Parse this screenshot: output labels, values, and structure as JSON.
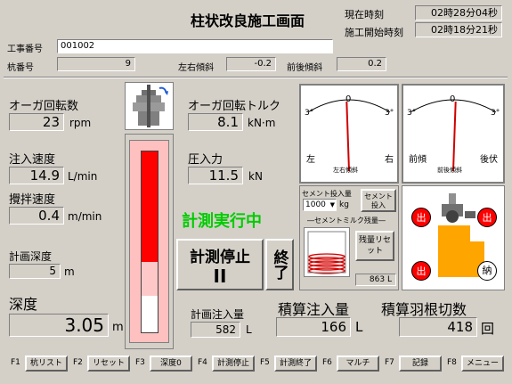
{
  "title": "柱状改良施工画面",
  "clock": {
    "now_label": "現在時刻",
    "now_value": "02時28分04秒",
    "start_label": "施工開始時刻",
    "start_value": "02時18分21秒"
  },
  "job": {
    "label": "工事番号",
    "value": "001002"
  },
  "pile": {
    "label": "杭番号",
    "value": "9"
  },
  "tilt_lr": {
    "label": "左右傾斜",
    "value": "-0.2"
  },
  "tilt_fb": {
    "label": "前後傾斜",
    "value": "0.2"
  },
  "auger_speed": {
    "label": "オーガ回転数",
    "value": "23",
    "unit": "rpm"
  },
  "auger_torque": {
    "label": "オーガ回転トルク",
    "value": "8.1",
    "unit": "kN·m"
  },
  "inject_speed": {
    "label": "注入速度",
    "value": "14.9",
    "unit": "L/min"
  },
  "pressure": {
    "label": "圧入力",
    "value": "11.5",
    "unit": "kN"
  },
  "mix_speed": {
    "label": "攪拌速度",
    "value": "0.4",
    "unit": "m/min"
  },
  "plan_depth": {
    "label": "計画深度",
    "value": "5",
    "unit": "m"
  },
  "depth": {
    "label": "深度",
    "value": "3.05",
    "unit": "m"
  },
  "status": "計測実行中",
  "buttons": {
    "stop_measure": "計測停止",
    "pause_symbol": "II",
    "finish": "終了"
  },
  "gauge_lr": {
    "scale_left": "3°",
    "scale_center": "0",
    "scale_right": "3°",
    "side_left": "左",
    "side_right": "右",
    "caption": "左右傾斜",
    "value": -0.2
  },
  "gauge_fb": {
    "scale_left": "3°",
    "scale_center": "0",
    "scale_right": "3°",
    "side_left": "前傾",
    "side_right": "後伏",
    "caption": "前後傾斜",
    "value": 0.2
  },
  "cement": {
    "input_label": "セメント投入量",
    "input_value": "1000",
    "input_unit": "kg",
    "input_button": "セメント投入",
    "milk_label": "―セメントミルク残量―",
    "reset_button": "残量リセット",
    "remain_value": "863",
    "remain_unit": "L",
    "tank_level": 0.45
  },
  "plan_inject": {
    "label": "計画注入量",
    "value": "582",
    "unit": "L"
  },
  "total_inject": {
    "label": "積算注入量",
    "value": "166",
    "unit": "L"
  },
  "total_blade": {
    "label": "積算羽根切数",
    "value": "418",
    "unit": "回"
  },
  "machine": {
    "out_label": "出",
    "delivery_label": "納"
  },
  "depth_bar": {
    "plan_fraction": 0.8,
    "current_fraction": 0.61
  },
  "colors": {
    "red": "#ff0000",
    "orange": "#ffa500",
    "green": "#00cc00",
    "bg": "#d4d0c8",
    "value_bg": "#d4d0c8"
  },
  "fkeys": [
    {
      "key": "F1",
      "label": "杭リスト"
    },
    {
      "key": "F2",
      "label": "リセット"
    },
    {
      "key": "F3",
      "label": "深度0"
    },
    {
      "key": "F4",
      "label": "計測停止"
    },
    {
      "key": "F5",
      "label": "計測終了"
    },
    {
      "key": "F6",
      "label": "マルチ"
    },
    {
      "key": "F7",
      "label": "記録"
    },
    {
      "key": "F8",
      "label": "メニュー"
    }
  ]
}
